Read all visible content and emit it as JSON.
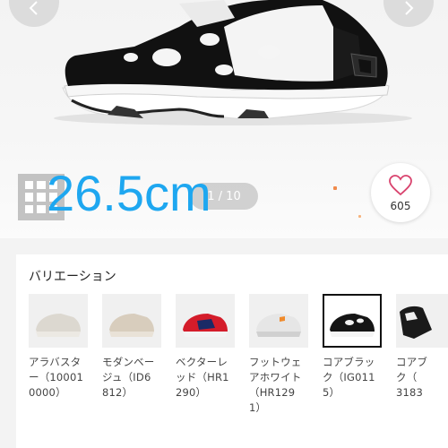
{
  "hero": {
    "size_overlay": "26.5cm",
    "pager": "1 / 10",
    "favorite_count": "605"
  },
  "variations": {
    "title": "バリエーション",
    "items": [
      {
        "label": "アラバスタ\nー（10001\n0000）",
        "colorway": "alabaster",
        "selected": false
      },
      {
        "label": "モダンベー\nジュ（ID6\n812）",
        "colorway": "modern-beige",
        "selected": false
      },
      {
        "label": "ベクターレ\nッド（HR1\n290）",
        "colorway": "vector-red",
        "selected": false
      },
      {
        "label": "フットウェ\nアホワイト\n（HR129\n1）",
        "colorway": "footwear-white",
        "selected": false
      },
      {
        "label": "コアブラッ\nク（IG011\n5）",
        "colorway": "core-black",
        "selected": true
      },
      {
        "label": "コアブ\nク（\n3183",
        "colorway": "core-black-2",
        "selected": false
      }
    ]
  },
  "colors": {
    "overlay_text": "#1ea7f0",
    "heart": "#d9436e",
    "panel_bg": "#f3f3f3"
  }
}
